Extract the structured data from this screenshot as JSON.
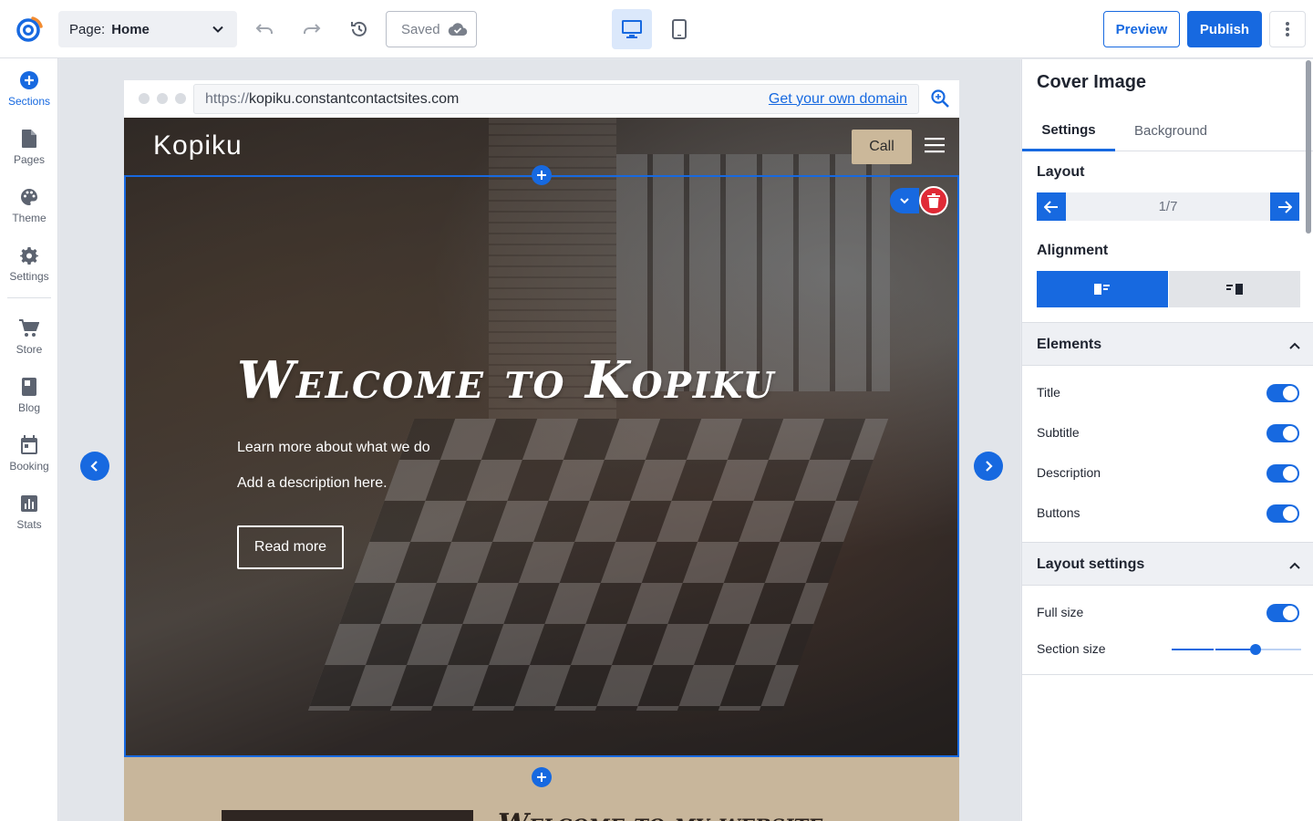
{
  "topbar": {
    "page_label": "Page:",
    "page_value": "Home",
    "saved_label": "Saved",
    "preview_label": "Preview",
    "publish_label": "Publish",
    "accent": "#1769e0"
  },
  "leftnav": {
    "items": [
      {
        "label": "Sections",
        "icon": "plus-circle-icon",
        "active": true
      },
      {
        "label": "Pages",
        "icon": "page-icon"
      },
      {
        "label": "Theme",
        "icon": "palette-icon"
      },
      {
        "label": "Settings",
        "icon": "gear-icon"
      },
      {
        "label": "Store",
        "icon": "cart-icon"
      },
      {
        "label": "Blog",
        "icon": "book-icon"
      },
      {
        "label": "Booking",
        "icon": "calendar-icon"
      },
      {
        "label": "Stats",
        "icon": "bar-chart-icon"
      }
    ]
  },
  "browser": {
    "url_protocol": "https://",
    "url_host": "kopiku.constantcontactsites.com",
    "own_domain_link": "Get your own domain"
  },
  "site": {
    "brand": "Kopiku",
    "call_label": "Call",
    "hero_title": "Welcome to Kopiku",
    "hero_subtitle": "Learn more about what we do",
    "hero_description": "Add a description here.",
    "hero_button": "Read more",
    "next_section_title": "Welcome to my website"
  },
  "panel": {
    "title": "Cover Image",
    "tabs": [
      "Settings",
      "Background"
    ],
    "active_tab": "Settings",
    "layout_label": "Layout",
    "layout_value": "1/7",
    "alignment_label": "Alignment",
    "elements_label": "Elements",
    "elements": [
      {
        "label": "Title",
        "on": true
      },
      {
        "label": "Subtitle",
        "on": true
      },
      {
        "label": "Description",
        "on": true
      },
      {
        "label": "Buttons",
        "on": true
      }
    ],
    "layout_settings_label": "Layout settings",
    "full_size_label": "Full size",
    "full_size_on": true,
    "section_size_label": "Section size",
    "section_size_fraction": 0.65
  }
}
